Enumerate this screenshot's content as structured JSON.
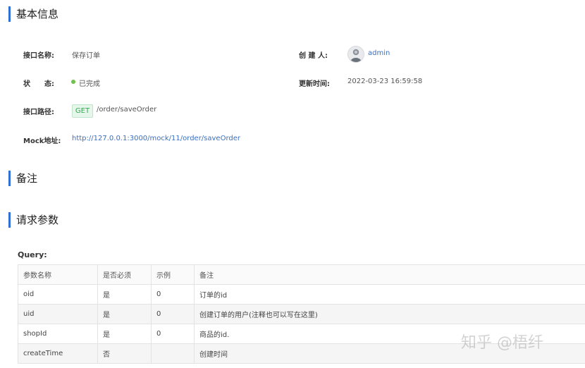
{
  "sections": {
    "basic_info": "基本信息",
    "notes": "备注",
    "request_params": "请求参数"
  },
  "info": {
    "name_label": "接口名称:",
    "name_value": "保存订单",
    "creator_label": "创 建 人:",
    "creator_value": "admin",
    "status_label": "状　　态:",
    "status_value": "已完成",
    "status_color": "#6cc24a",
    "updated_label": "更新时间:",
    "updated_value": "2022-03-23 16:59:58",
    "path_label": "接口路径:",
    "method": "GET",
    "path_value": "/order/saveOrder",
    "mock_label": "Mock地址:",
    "mock_url": "http://127.0.0.1:3000/mock/11/order/saveOrder"
  },
  "query": {
    "label": "Query:",
    "headers": [
      "参数名称",
      "是否必须",
      "示例",
      "备注"
    ],
    "rows": [
      [
        "oid",
        "是",
        "0",
        "订单的id"
      ],
      [
        "uid",
        "是",
        "0",
        "创建订单的用户(注释也可以写在这里)"
      ],
      [
        "shopId",
        "是",
        "0",
        "商品的id."
      ],
      [
        "createTime",
        "否",
        "",
        "创建时间"
      ]
    ]
  },
  "watermark": "知乎 @梧纤",
  "colors": {
    "accent": "#2f6fd6",
    "link": "#3a6fbf",
    "get_tag": "#34a853"
  }
}
